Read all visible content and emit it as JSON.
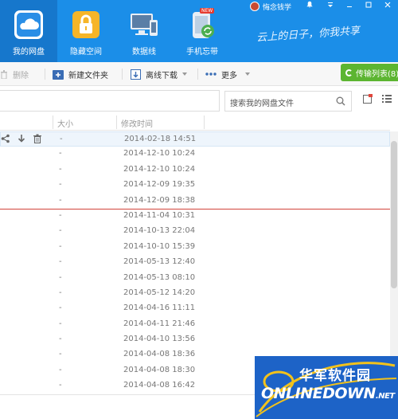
{
  "nav": {
    "items": [
      {
        "label": "我的网盘",
        "active": true
      },
      {
        "label": "隐藏空间",
        "active": false
      },
      {
        "label": "数据线",
        "active": false
      },
      {
        "label": "手机忘带",
        "active": false,
        "badge": "NEW"
      }
    ]
  },
  "user": {
    "name": "悔念钱学"
  },
  "slogan": "云上的日子，你我共享",
  "toolbar": {
    "delete_label": "删除",
    "new_folder_label": "新建文件夹",
    "offline_download_label": "离线下载",
    "more_label": "更多",
    "transfer_list_label": "传输列表(8)"
  },
  "search": {
    "placeholder": "搜索我的网盘文件"
  },
  "list": {
    "columns": {
      "size": "大小",
      "modified": "修改时间"
    },
    "rows": [
      {
        "size": "-",
        "time": "2014-02-18 14:51"
      },
      {
        "size": "-",
        "time": "2014-12-10 10:24"
      },
      {
        "size": "-",
        "time": "2014-12-10 10:24"
      },
      {
        "size": "-",
        "time": "2014-12-09 19:35"
      },
      {
        "size": "-",
        "time": "2014-12-09 18:38"
      },
      {
        "size": "-",
        "time": "2014-11-04 10:31"
      },
      {
        "size": "-",
        "time": "2014-10-13 22:04"
      },
      {
        "size": "-",
        "time": "2014-10-10 15:39"
      },
      {
        "size": "-",
        "time": "2014-05-13 12:40"
      },
      {
        "size": "-",
        "time": "2014-05-13 08:10"
      },
      {
        "size": "-",
        "time": "2014-05-12 14:20"
      },
      {
        "size": "-",
        "time": "2014-04-16 11:11"
      },
      {
        "size": "-",
        "time": "2014-04-11 21:46"
      },
      {
        "size": "-",
        "time": "2014-04-10 13:56"
      },
      {
        "size": "-",
        "time": "2014-04-08 18:36"
      },
      {
        "size": "-",
        "time": "2014-04-08 18:30"
      },
      {
        "size": "-",
        "time": "2014-04-08 16:42"
      }
    ]
  },
  "watermark": {
    "cn": "华军软件园",
    "en": "ONLINEDOWN",
    "suffix": ".NET"
  },
  "colors": {
    "accent": "#1b8ee8",
    "transfer": "#5cb531",
    "divider_red": "#d2443a"
  }
}
